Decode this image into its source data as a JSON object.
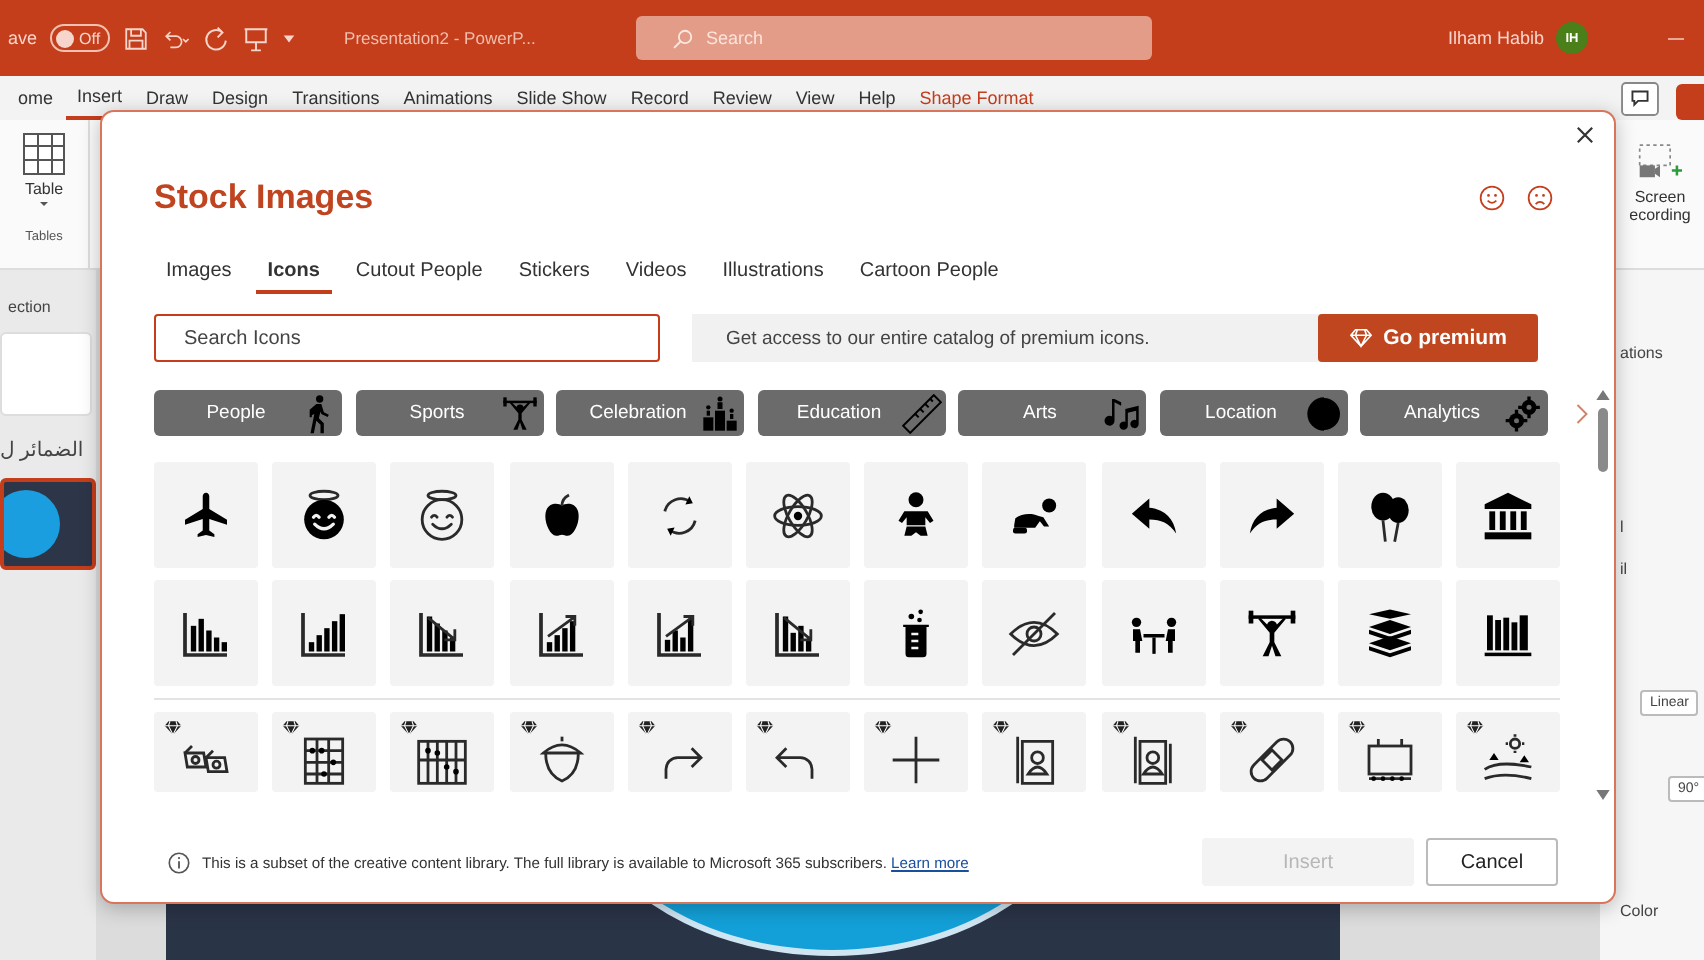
{
  "title_bar": {
    "autosave": {
      "label": "ave",
      "toggle_text": "Off",
      "on": false
    },
    "document_title": "Presentation2  -  PowerP...",
    "search": {
      "placeholder": "Search"
    },
    "user": {
      "name": "Ilham Habib",
      "initials": "IH"
    }
  },
  "ribbon_tabs": [
    {
      "label": "ome",
      "selected": false,
      "kind": "standard"
    },
    {
      "label": "Insert",
      "selected": true,
      "kind": "standard"
    },
    {
      "label": "Draw",
      "selected": false,
      "kind": "standard"
    },
    {
      "label": "Design",
      "selected": false,
      "kind": "standard"
    },
    {
      "label": "Transitions",
      "selected": false,
      "kind": "standard"
    },
    {
      "label": "Animations",
      "selected": false,
      "kind": "standard"
    },
    {
      "label": "Slide Show",
      "selected": false,
      "kind": "standard"
    },
    {
      "label": "Record",
      "selected": false,
      "kind": "standard"
    },
    {
      "label": "Review",
      "selected": false,
      "kind": "standard"
    },
    {
      "label": "View",
      "selected": false,
      "kind": "standard"
    },
    {
      "label": "Help",
      "selected": false,
      "kind": "standard"
    },
    {
      "label": "Shape Format",
      "selected": false,
      "kind": "contextual"
    }
  ],
  "ribbon": {
    "table_button": "Table",
    "table_group": "Tables",
    "recording_button": "Screen\necording"
  },
  "left_panel": {
    "section_label": "ection",
    "slide_label": "الضمائر ل"
  },
  "right_panel": {
    "section_label": "ations",
    "fragments": [
      "l",
      "il"
    ],
    "dropdown_value": "Linear",
    "angle_value": "90°",
    "color_label": "Color"
  },
  "dialog": {
    "title": "Stock Images",
    "tabs": [
      {
        "label": "Images",
        "selected": false
      },
      {
        "label": "Icons",
        "selected": true
      },
      {
        "label": "Cutout People",
        "selected": false
      },
      {
        "label": "Stickers",
        "selected": false
      },
      {
        "label": "Videos",
        "selected": false
      },
      {
        "label": "Illustrations",
        "selected": false
      },
      {
        "label": "Cartoon People",
        "selected": false
      }
    ],
    "search": {
      "placeholder": "Search Icons"
    },
    "premium_banner": {
      "text": "Get access to our entire catalog of premium icons.",
      "button": "Go premium"
    },
    "categories": [
      "People",
      "Sports",
      "Celebration",
      "Education",
      "Arts",
      "Location",
      "Analytics"
    ],
    "tiles": [
      {
        "premium": false
      },
      {
        "premium": false
      },
      {
        "premium": false
      },
      {
        "premium": false
      },
      {
        "premium": false
      },
      {
        "premium": false
      },
      {
        "premium": false
      },
      {
        "premium": false
      },
      {
        "premium": false
      },
      {
        "premium": false
      },
      {
        "premium": false
      },
      {
        "premium": false
      },
      {
        "premium": false
      },
      {
        "premium": false
      },
      {
        "premium": false
      },
      {
        "premium": false
      },
      {
        "premium": false
      },
      {
        "premium": false
      },
      {
        "premium": false
      },
      {
        "premium": false
      },
      {
        "premium": false
      },
      {
        "premium": false
      },
      {
        "premium": false
      },
      {
        "premium": false
      },
      {
        "premium": true
      },
      {
        "premium": true
      },
      {
        "premium": true
      },
      {
        "premium": true
      },
      {
        "premium": true
      },
      {
        "premium": true
      },
      {
        "premium": true
      },
      {
        "premium": true
      },
      {
        "premium": true
      },
      {
        "premium": true
      },
      {
        "premium": true
      },
      {
        "premium": true
      }
    ],
    "footer": {
      "info": "This is a subset of the creative content library. The full library is available to Microsoft 365 subscribers.",
      "link": "Learn more"
    },
    "buttons": [
      {
        "label": "Insert",
        "disabled": true
      },
      {
        "label": "Cancel",
        "disabled": false
      }
    ]
  }
}
